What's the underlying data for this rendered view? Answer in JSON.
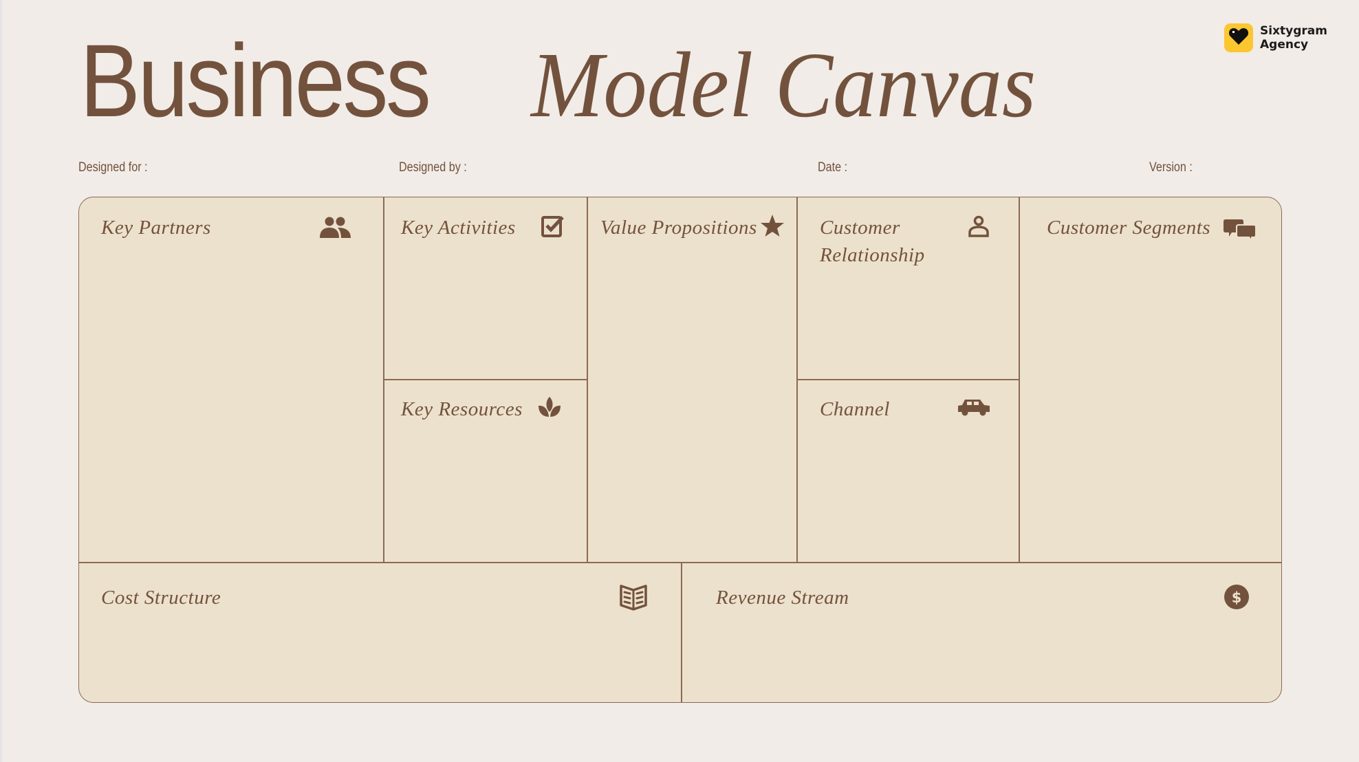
{
  "header": {
    "title_part1": "Business",
    "title_part2": "Model Canvas"
  },
  "brand": {
    "name_line1": "Sixtygram",
    "name_line2": "Agency",
    "logo_icon": "heart-icon",
    "badge_color": "#fcc631"
  },
  "meta": {
    "designed_for": "Designed for :",
    "designed_by": "Designed by :",
    "date": "Date :",
    "version": "Version :"
  },
  "colors": {
    "accent": "#73523d",
    "panel": "#ece1cc",
    "background": "#f1ece7"
  },
  "blocks": {
    "key_partners": {
      "title": "Key Partners",
      "icon": "people-icon"
    },
    "key_activities": {
      "title": "Key Activities",
      "icon": "checkbox-icon"
    },
    "key_resources": {
      "title": "Key Resources",
      "icon": "leaf-icon"
    },
    "value_propositions": {
      "title": "Value Propositions",
      "icon": "star-icon"
    },
    "customer_relationship": {
      "title_line1": "Customer",
      "title_line2": "Relationship",
      "icon": "user-icon"
    },
    "channel": {
      "title": "Channel",
      "icon": "car-icon"
    },
    "customer_segments": {
      "title": "Customer Segments",
      "icon": "chat-bubbles-icon"
    },
    "cost_structure": {
      "title": "Cost Structure",
      "icon": "book-icon"
    },
    "revenue_stream": {
      "title": "Revenue Stream",
      "icon": "dollar-coin-icon"
    }
  }
}
